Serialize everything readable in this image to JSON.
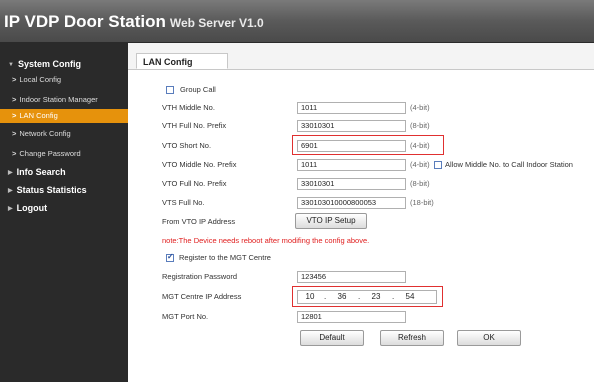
{
  "header": {
    "title": "IP VDP Door Station",
    "subtitle": "Web Server V1.0"
  },
  "sidebar": {
    "system_config": "System Config",
    "items": [
      {
        "label": "Local Config"
      },
      {
        "label": "Indoor Station Manager"
      },
      {
        "label": "LAN Config"
      },
      {
        "label": "Network Config"
      },
      {
        "label": "Change Password"
      }
    ],
    "info_search": "Info Search",
    "status_statistics": "Status Statistics",
    "logout": "Logout"
  },
  "tab": {
    "label": "LAN Config"
  },
  "form": {
    "group_call": {
      "label": "Group Call",
      "checked": false
    },
    "vth_middle_no": {
      "label": "VTH Middle No.",
      "value": "1011",
      "hint": "(4-bit)"
    },
    "vth_full_no_prefix": {
      "label": "VTH Full No. Prefix",
      "value": "33010301",
      "hint": "(8-bit)"
    },
    "vto_short_no": {
      "label": "VTO Short No.",
      "value": "6901",
      "hint": "(4-bit)"
    },
    "vto_middle_no_prefix": {
      "label": "VTO Middle No. Prefix",
      "value": "1011",
      "hint": "(4-bit)",
      "checkbox_label": "Allow Middle No. to Call Indoor Station"
    },
    "vto_full_no_prefix": {
      "label": "VTO Full No. Prefix",
      "value": "33010301",
      "hint": "(8-bit)"
    },
    "vts_full_no": {
      "label": "VTS Full No.",
      "value": "330103010000800053",
      "hint": "(18-bit)"
    },
    "from_vto_ip": {
      "label": "From VTO IP Address",
      "button": "VTO IP Setup"
    },
    "note": "note:The Device needs reboot after modifing the config above.",
    "register_mgt": {
      "label": "Register to the MGT Centre",
      "checked": true
    },
    "registration_password": {
      "label": "Registration Password",
      "value": "123456"
    },
    "mgt_ip": {
      "label": "MGT Centre IP Address",
      "octets": [
        "10",
        "36",
        "23",
        "54"
      ],
      "separator": "."
    },
    "mgt_port": {
      "label": "MGT Port No.",
      "value": "12801"
    }
  },
  "buttons": {
    "default": "Default",
    "refresh": "Refresh",
    "ok": "OK"
  },
  "colors": {
    "active_item": "#e6920c",
    "highlight_border": "#e03030",
    "note": "#e02020",
    "sidebar_bg": "#2a2a2a"
  },
  "icons": {
    "submenu": "chevron-right-icon",
    "section": "triangle-right-icon"
  }
}
